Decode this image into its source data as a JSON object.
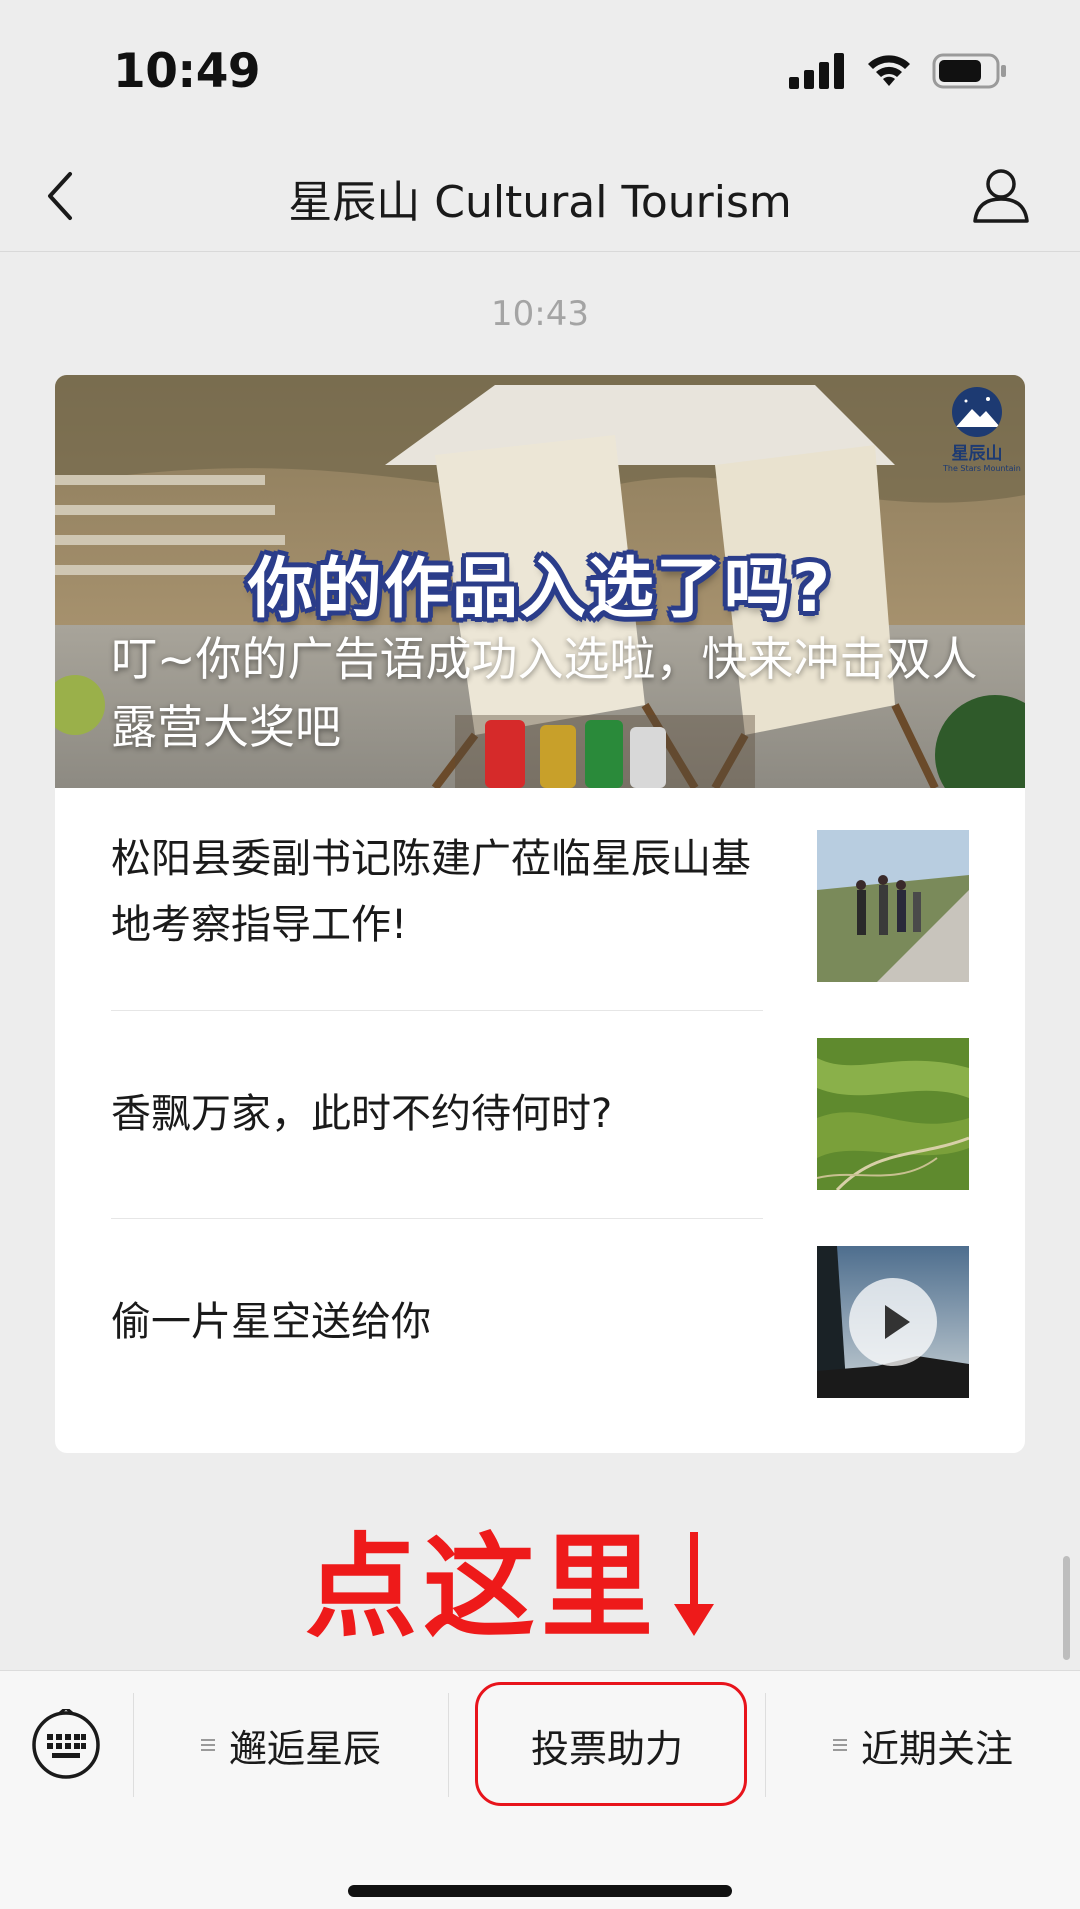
{
  "status_bar": {
    "time": "10:49",
    "icons": [
      "cellular-signal-icon",
      "wifi-icon",
      "battery-icon"
    ]
  },
  "nav": {
    "title": "星辰山 Cultural Tourism",
    "back_icon": "chevron-left-icon",
    "profile_icon": "person-icon"
  },
  "message": {
    "time": "10:43"
  },
  "cover": {
    "headline": "你的作品入选了吗?",
    "caption": "叮~你的广告语成功入选啦，快来冲击双人露营大奖吧",
    "logo_text": "星辰山",
    "logo_subtext": "The Stars Mountain"
  },
  "articles": [
    {
      "title": "松阳县委副书记陈建广莅临星辰山基地考察指导工作!",
      "thumbnail": "officials-on-mountain-walkway"
    },
    {
      "title": "香飘万家，此时不约待何时?",
      "thumbnail": "terraced-green-hills"
    },
    {
      "title": "偷一片星空送给你",
      "thumbnail": "dusk-sky-video",
      "has_video": true
    }
  ],
  "annotation": {
    "text": "点这里",
    "arrow": "down-arrow-icon"
  },
  "menu": {
    "keyboard_icon": "keyboard-icon",
    "items": [
      {
        "label": "邂逅星辰",
        "has_submenu": true
      },
      {
        "label": "投票助力",
        "has_submenu": false,
        "highlighted": true
      },
      {
        "label": "近期关注",
        "has_submenu": true
      }
    ]
  },
  "colors": {
    "background": "#ededed",
    "card": "#ffffff",
    "annotation_red": "#ee1a1a",
    "headline_outline": "#2b3d8a"
  }
}
